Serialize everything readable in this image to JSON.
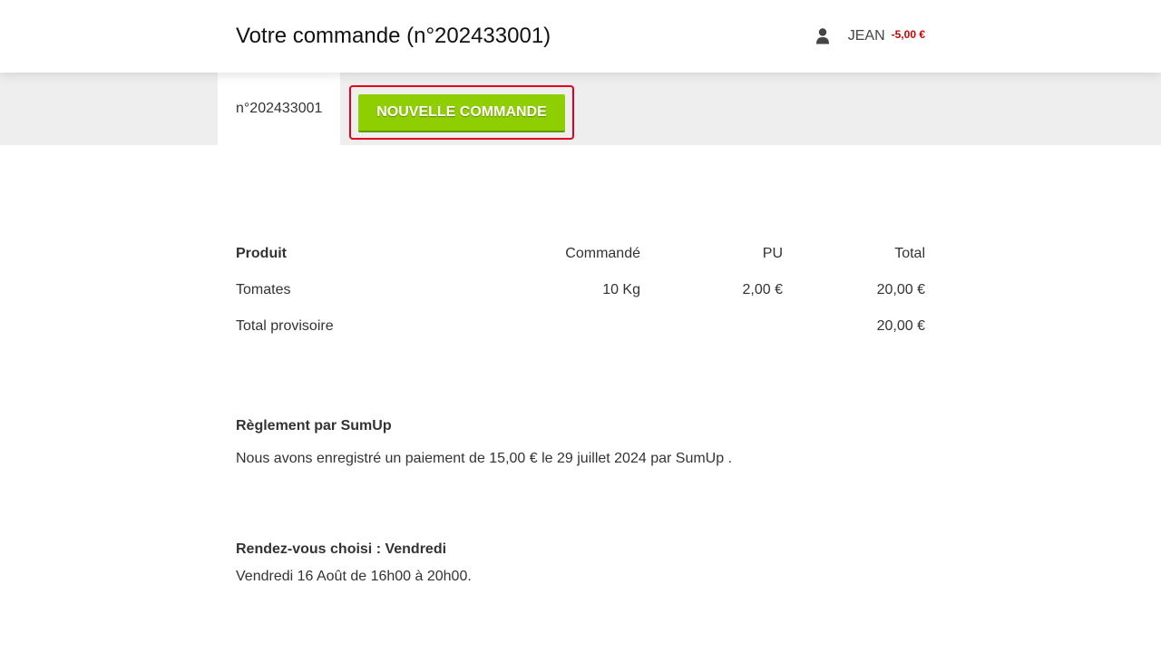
{
  "header": {
    "title": "Votre commande (n°202433001)",
    "user_name": "JEAN",
    "balance": "-5,00 €"
  },
  "tabs": {
    "active_label": "n°202433001",
    "new_order_label": "NOUVELLE COMMANDE"
  },
  "order_table": {
    "headers": {
      "product": "Produit",
      "ordered": "Commandé",
      "unit_price": "PU",
      "total": "Total"
    },
    "rows": [
      {
        "product": "Tomates",
        "ordered": "10 Kg",
        "unit_price": "2,00 €",
        "total": "20,00 €"
      }
    ],
    "subtotal_label": "Total provisoire",
    "subtotal_value": "20,00 €"
  },
  "payment": {
    "title": "Règlement par SumUp",
    "text": "Nous avons enregistré un paiement de 15,00 € le 29 juillet 2024 par SumUp ."
  },
  "appointment": {
    "title": "Rendez-vous choisi : Vendredi",
    "text": "Vendredi 16 Août de 16h00 à 20h00."
  },
  "colors": {
    "accent_green": "#8fce00",
    "balance_red": "#cc0000",
    "highlight_red": "#e3001b"
  },
  "icons": {
    "user": "user-icon"
  }
}
